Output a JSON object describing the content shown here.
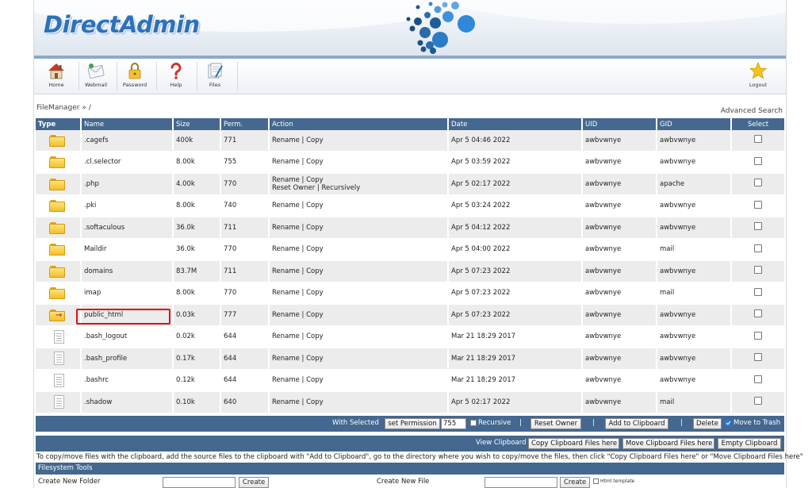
{
  "header": {
    "logo_text": "DirectAdmin",
    "brand_color": "#2d72b8"
  },
  "toolbar": {
    "items": [
      {
        "label": "Home",
        "icon": "home-icon"
      },
      {
        "label": "Webmail",
        "icon": "webmail-icon"
      },
      {
        "label": "Password",
        "icon": "lock-icon"
      },
      {
        "label": "Help",
        "icon": "help-icon"
      },
      {
        "label": "Files",
        "icon": "files-icon"
      }
    ],
    "logout_label": "Logout"
  },
  "breadcrumb": "FileManager » /",
  "advanced_search": "Advanced Search",
  "table": {
    "headers": [
      "Type",
      "Name",
      "Size",
      "Perm.",
      "Action",
      "Date",
      "UID",
      "GID",
      "Select"
    ],
    "rows": [
      {
        "type": "folder",
        "name": ".cagefs",
        "size": "400k",
        "perm": "771",
        "action": "Rename | Copy",
        "action2": "",
        "date": "Apr 5 04:46 2022",
        "uid": "awbvwnye",
        "gid": "awbvwnye"
      },
      {
        "type": "folder",
        "name": ".cl.selector",
        "size": "8.00k",
        "perm": "755",
        "action": "Rename | Copy",
        "action2": "",
        "date": "Apr 5 03:59 2022",
        "uid": "awbvwnye",
        "gid": "awbvwnye"
      },
      {
        "type": "folder",
        "name": ".php",
        "size": "4.00k",
        "perm": "770",
        "action": "Rename | Copy",
        "action2": "Reset Owner | Recursively",
        "date": "Apr 5 02:17 2022",
        "uid": "awbvwnye",
        "gid": "apache"
      },
      {
        "type": "folder",
        "name": ".pki",
        "size": "8.00k",
        "perm": "740",
        "action": "Rename | Copy",
        "action2": "",
        "date": "Apr 5 03:24 2022",
        "uid": "awbvwnye",
        "gid": "awbvwnye"
      },
      {
        "type": "folder",
        "name": ".softaculous",
        "size": "36.0k",
        "perm": "711",
        "action": "Rename | Copy",
        "action2": "",
        "date": "Apr 5 04:12 2022",
        "uid": "awbvwnye",
        "gid": "awbvwnye"
      },
      {
        "type": "folder",
        "name": "Maildir",
        "size": "36.0k",
        "perm": "770",
        "action": "Rename | Copy",
        "action2": "",
        "date": "Apr 5 04:00 2022",
        "uid": "awbvwnye",
        "gid": "mail"
      },
      {
        "type": "folder",
        "name": "domains",
        "size": "83.7M",
        "perm": "711",
        "action": "Rename | Copy",
        "action2": "",
        "date": "Apr 5 07:23 2022",
        "uid": "awbvwnye",
        "gid": "awbvwnye"
      },
      {
        "type": "folder",
        "name": "imap",
        "size": "8.00k",
        "perm": "770",
        "action": "Rename | Copy",
        "action2": "",
        "date": "Apr 5 07:23 2022",
        "uid": "awbvwnye",
        "gid": "mail"
      },
      {
        "type": "folder-link",
        "name": "public_html",
        "size": "0.03k",
        "perm": "777",
        "action": "Rename | Copy",
        "action2": "",
        "date": "Apr 5 07:23 2022",
        "uid": "awbvwnye",
        "gid": "awbvwnye"
      },
      {
        "type": "file",
        "name": ".bash_logout",
        "size": "0.02k",
        "perm": "644",
        "action": "Rename | Copy",
        "action2": "",
        "date": "Mar 21 18:29 2017",
        "uid": "awbvwnye",
        "gid": "awbvwnye"
      },
      {
        "type": "file",
        "name": ".bash_profile",
        "size": "0.17k",
        "perm": "644",
        "action": "Rename | Copy",
        "action2": "",
        "date": "Mar 21 18:29 2017",
        "uid": "awbvwnye",
        "gid": "awbvwnye"
      },
      {
        "type": "file",
        "name": ".bashrc",
        "size": "0.12k",
        "perm": "644",
        "action": "Rename | Copy",
        "action2": "",
        "date": "Mar 21 18:29 2017",
        "uid": "awbvwnye",
        "gid": "awbvwnye"
      },
      {
        "type": "file",
        "name": ".shadow",
        "size": "0.10k",
        "perm": "640",
        "action": "Rename | Copy",
        "action2": "",
        "date": "Apr 5 02:17 2022",
        "uid": "awbvwnye",
        "gid": "mail"
      }
    ]
  },
  "with_selected": {
    "label": "With Selected",
    "set_permission": "set Permission",
    "permission_value": "755",
    "recursive": "Recursive",
    "reset_owner": "Reset Owner",
    "add_to_clipboard": "Add to Clipboard",
    "delete": "Delete",
    "move_to_trash": "Move to Trash",
    "separator": "|"
  },
  "clipboard": {
    "view": "View Clipboard",
    "copy_here": "Copy Clipboard Files here",
    "move_here": "Move Clipboard Files here",
    "empty": "Empty Clipboard"
  },
  "help_text": "To copy/move files with the clipboard, add the source files to the clipboard with \"Add to Clipboard\", go to the directory where you wish to copy/move the files, then click \"Copy Clipboard Files here\" or \"Move Clipboard Files here\"",
  "filesystem_tools": {
    "title": "Filesystem Tools",
    "create_folder_label": "Create New Folder",
    "create_folder_button": "Create",
    "create_file_label": "Create New File",
    "create_file_button": "Create",
    "html_template": "Html template"
  }
}
